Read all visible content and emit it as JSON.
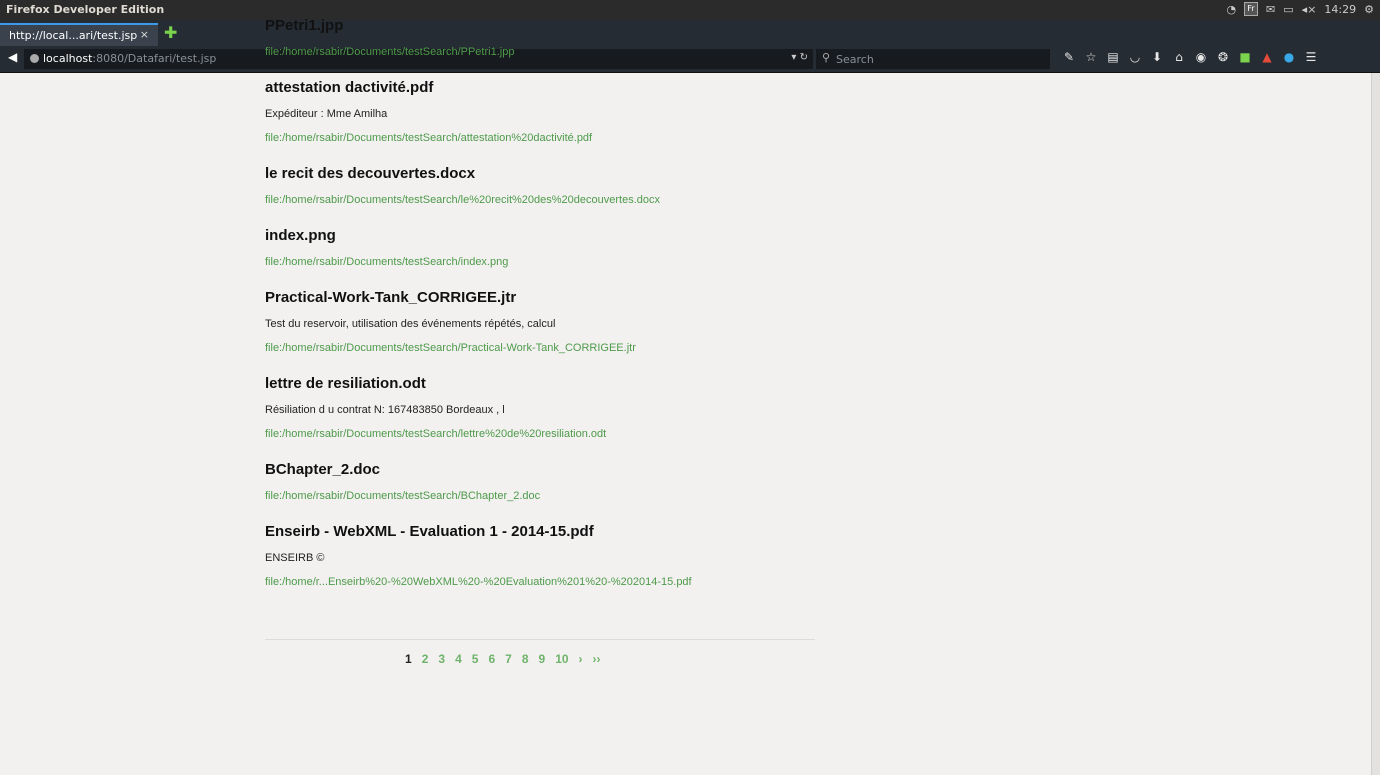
{
  "window": {
    "title": "Firefox Developer Edition",
    "clock": "14:29",
    "lang": "Fr"
  },
  "tab": {
    "title": "http://local...ari/test.jsp"
  },
  "nav": {
    "url_host": "localhost",
    "url_rest": ":8080/Datafari/test.jsp",
    "search_placeholder": "Search"
  },
  "results": [
    {
      "title": "PPetri1.jpp",
      "snippet": "",
      "url": "file:/home/rsabir/Documents/testSearch/PPetri1.jpp"
    },
    {
      "title": "attestation dactivité.pdf",
      "snippet": "Expéditeur : Mme Amilha",
      "url": "file:/home/rsabir/Documents/testSearch/attestation%20dactivité.pdf"
    },
    {
      "title": "le recit des decouvertes.docx",
      "snippet": "",
      "url": "file:/home/rsabir/Documents/testSearch/le%20recit%20des%20decouvertes.docx"
    },
    {
      "title": "index.png",
      "snippet": "",
      "url": "file:/home/rsabir/Documents/testSearch/index.png"
    },
    {
      "title": "Practical-Work-Tank_CORRIGEE.jtr",
      "snippet": "Test du reservoir, utilisation des événements répétés, calcul",
      "url": "file:/home/rsabir/Documents/testSearch/Practical-Work-Tank_CORRIGEE.jtr"
    },
    {
      "title": "lettre de resiliation.odt",
      "snippet": "Résiliation d u contrat N: 167483850 Bordeaux , l",
      "url": "file:/home/rsabir/Documents/testSearch/lettre%20de%20resiliation.odt"
    },
    {
      "title": "BChapter_2.doc",
      "snippet": "",
      "url": "file:/home/rsabir/Documents/testSearch/BChapter_2.doc"
    },
    {
      "title": "Enseirb - WebXML - Evaluation 1 - 2014-15.pdf",
      "snippet": "ENSEIRB ©",
      "url": "file:/home/r...Enseirb%20-%20WebXML%20-%20Evaluation%201%20-%202014-15.pdf"
    }
  ],
  "pagination": {
    "pages": [
      "1",
      "2",
      "3",
      "4",
      "5",
      "6",
      "7",
      "8",
      "9",
      "10"
    ],
    "current": "1",
    "next": "›",
    "last": "››"
  }
}
